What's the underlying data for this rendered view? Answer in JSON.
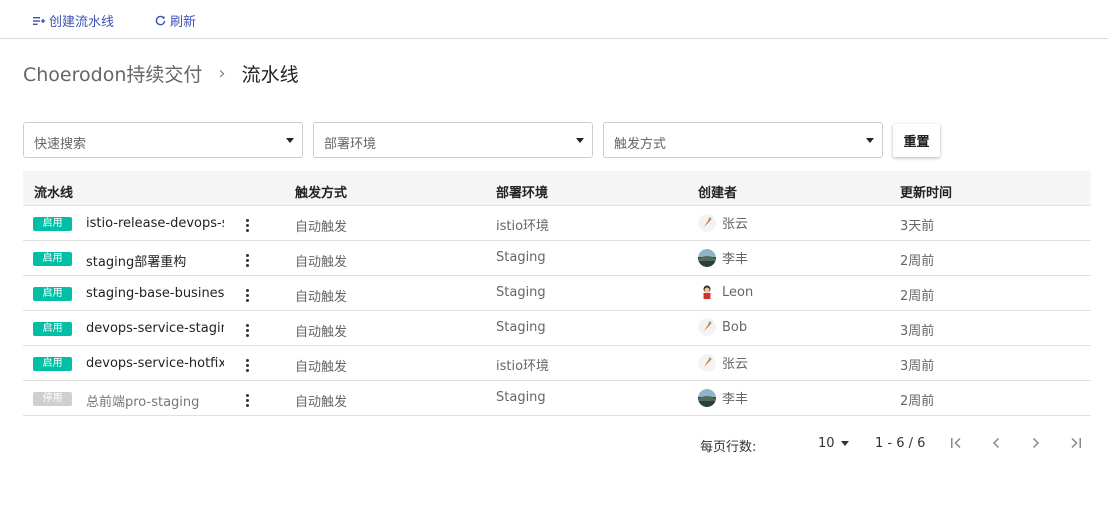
{
  "toolbar": {
    "create_label": "创建流水线",
    "refresh_label": "刷新"
  },
  "breadcrumb": {
    "root": "Choerodon持续交付",
    "separator": "›",
    "current": "流水线"
  },
  "filters": {
    "search_placeholder": "快速搜索",
    "env_placeholder": "部署环境",
    "trigger_placeholder": "触发方式",
    "reset_label": "重置"
  },
  "table": {
    "columns": [
      "流水线",
      "触发方式",
      "部署环境",
      "创建者",
      "更新时间"
    ],
    "rows": [
      {
        "status": "启用",
        "enabled": true,
        "name": "istio-release-devops-ser",
        "trigger": "自动触发",
        "env": "istio环境",
        "creator": "张云",
        "avatar": "carrot",
        "updated": "3天前"
      },
      {
        "status": "启用",
        "enabled": true,
        "name": "staging部署重构",
        "trigger": "自动触发",
        "env": "Staging",
        "creator": "李丰",
        "avatar": "landscape",
        "updated": "2周前"
      },
      {
        "status": "启用",
        "enabled": true,
        "name": "staging-base-business",
        "trigger": "自动触发",
        "env": "Staging",
        "creator": "Leon",
        "avatar": "character",
        "updated": "2周前"
      },
      {
        "status": "启用",
        "enabled": true,
        "name": "devops-service-staging",
        "trigger": "自动触发",
        "env": "Staging",
        "creator": "Bob",
        "avatar": "carrot",
        "updated": "3周前"
      },
      {
        "status": "启用",
        "enabled": true,
        "name": "devops-service-hotfix",
        "trigger": "自动触发",
        "env": "istio环境",
        "creator": "张云",
        "avatar": "carrot",
        "updated": "3周前"
      },
      {
        "status": "停用",
        "enabled": false,
        "name": "总前端pro-staging",
        "trigger": "自动触发",
        "env": "Staging",
        "creator": "李丰",
        "avatar": "landscape",
        "updated": "2周前"
      }
    ]
  },
  "pagination": {
    "rows_per_page_label": "每页行数:",
    "rows_per_page": "10",
    "range": "1 - 6 / 6"
  },
  "colors": {
    "accent": "#3f51b5",
    "enabled_badge": "#00bfa5",
    "disabled_badge": "#cfcfcf"
  }
}
